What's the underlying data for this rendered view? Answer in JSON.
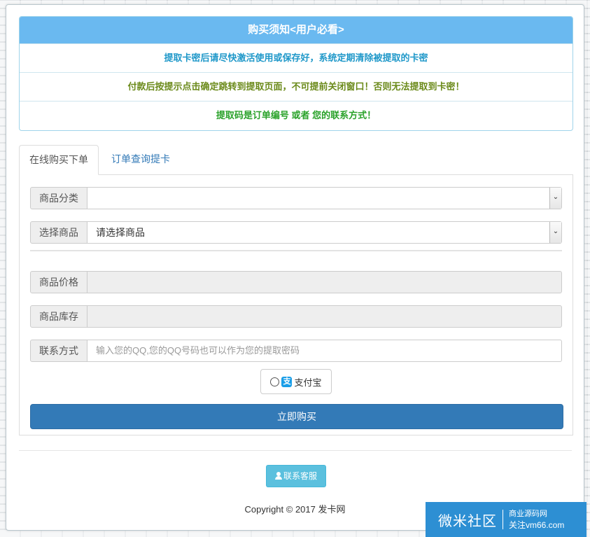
{
  "notice": {
    "title": "购买须知<用户必看>",
    "rows": [
      {
        "text": "提取卡密后请尽快激活使用或保存好，系统定期清除被提取的卡密",
        "color": "#1f98c9"
      },
      {
        "text": "付款后按提示点击确定跳转到提取页面，不可提前关闭窗口！否则无法提取到卡密！",
        "color": "#6b8a1a"
      },
      {
        "text": "提取码是订单编号 或者 您的联系方式！",
        "color": "#2aa22a"
      }
    ]
  },
  "tabs": {
    "buy": "在线购买下单",
    "query": "订单查询提卡"
  },
  "form": {
    "category_label": "商品分类",
    "category_value": "",
    "product_label": "选择商品",
    "product_value": "请选择商品",
    "price_label": "商品价格",
    "price_value": "",
    "stock_label": "商品库存",
    "stock_value": "",
    "contact_label": "联系方式",
    "contact_placeholder": "输入您的QQ,您的QQ号码也可以作为您的提取密码",
    "payment_label": "支付宝",
    "buy_button": "立即购买"
  },
  "footer": {
    "contact_button": "联系客服",
    "copyright": "Copyright © 2017 发卡网"
  },
  "watermark": {
    "main": "微米社区",
    "line1": "商业源码网",
    "line2": "关注vm66.com"
  },
  "colors": {
    "accent": "#337ab7",
    "notice_header": "#6ab9f0",
    "contact_button": "#5bc0de"
  }
}
